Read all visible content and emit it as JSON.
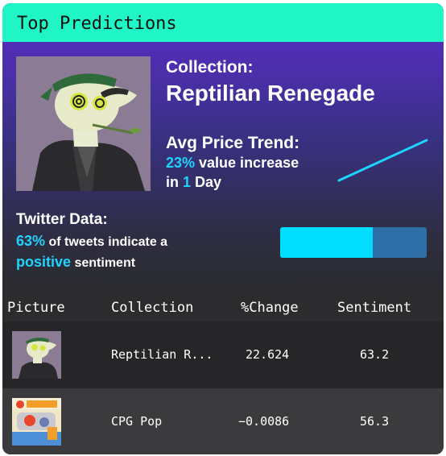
{
  "header": {
    "title": "Top Predictions"
  },
  "hero": {
    "collection_label": "Collection:",
    "collection_name": "Reptilian Renegade",
    "trend_label": "Avg Price Trend:",
    "trend_percent": "23%",
    "trend_text": " value increase",
    "trend_in": "in ",
    "trend_days": "1",
    "trend_unit": " Day",
    "trend_line_color": "#1fd3ff"
  },
  "twitter": {
    "label": "Twitter Data:",
    "percent": "63%",
    "text1": " of tweets indicate a",
    "positive": "positive",
    "text2": " sentiment",
    "bar_fraction": 0.63,
    "bar_fill_color": "#00ddff",
    "bar_track_color": "#2f6fa8"
  },
  "table": {
    "headers": {
      "picture": "Picture",
      "collection": "Collection",
      "change": "%Change",
      "sentiment": "Sentiment"
    },
    "rows": [
      {
        "collection": "Reptilian R...",
        "change": "22.624",
        "sentiment": "63.2",
        "thumb": "reptile-nft-image"
      },
      {
        "collection": "CPG Pop",
        "change": "−0.0086",
        "sentiment": "56.3",
        "thumb": "pop-library-nft-image"
      }
    ]
  },
  "colors": {
    "accent_teal": "#1ff5c5",
    "highlight_cyan": "#1fd3ff",
    "purple": "#5b2bc7"
  }
}
